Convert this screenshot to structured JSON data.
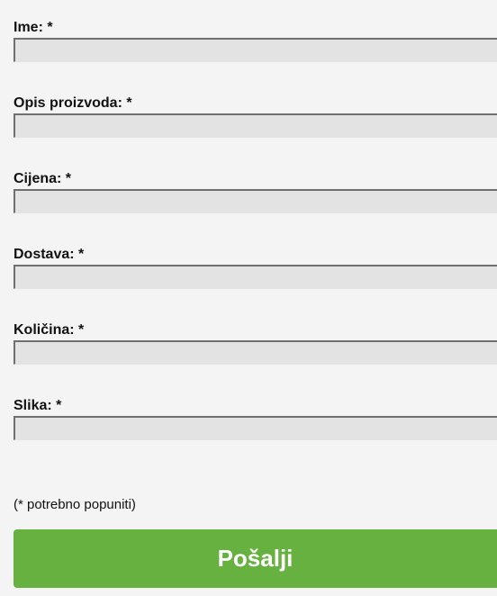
{
  "form": {
    "fields": [
      {
        "label": "Ime: *",
        "value": ""
      },
      {
        "label": "Opis proizvoda: *",
        "value": ""
      },
      {
        "label": "Cijena: *",
        "value": ""
      },
      {
        "label": "Dostava: *",
        "value": ""
      },
      {
        "label": "Količina: *",
        "value": ""
      },
      {
        "label": "Slika: *",
        "value": ""
      }
    ],
    "required_note": "(* potrebno popuniti)",
    "submit_label": "Pošalji"
  },
  "colors": {
    "background": "#f4f4f4",
    "input_fill": "#e3e3e3",
    "input_border": "#6f6f6f",
    "submit_button": "#66b13f",
    "submit_text": "#ffffff"
  }
}
